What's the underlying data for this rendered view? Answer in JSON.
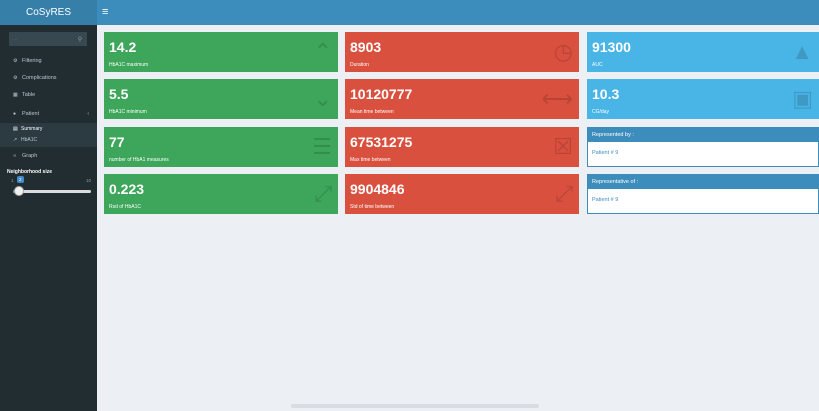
{
  "app": {
    "title": "CoSyRES"
  },
  "search": {
    "placeholder": "..."
  },
  "sidebar": {
    "items": [
      {
        "label": "Filtering",
        "icon": "filter-icon"
      },
      {
        "label": "Complications",
        "icon": "gears-icon"
      },
      {
        "label": "Table",
        "icon": "table-icon"
      },
      {
        "label": "Patient",
        "icon": "user-icon"
      }
    ],
    "submenu": [
      {
        "label": "Summary",
        "icon": "summary-icon"
      },
      {
        "label": "HbA1C",
        "icon": "line-chart-icon"
      }
    ],
    "graph": {
      "label": "Graph",
      "icon": "share-icon"
    }
  },
  "slider": {
    "label": "Neighborhood size",
    "min": "1",
    "max": "10",
    "value": "2"
  },
  "value_boxes": [
    {
      "value": "14.2",
      "subtitle": "HbA1C maximum",
      "color": "#3da65a"
    },
    {
      "value": "8903",
      "subtitle": "Duration",
      "color": "#d9503f"
    },
    {
      "value": "91300",
      "subtitle": "AUC",
      "color": "#49b5e7"
    },
    {
      "value": "5.5",
      "subtitle": "HbA1C minimum",
      "color": "#3da65a"
    },
    {
      "value": "10120777",
      "subtitle": "Mean time between",
      "color": "#d9503f"
    },
    {
      "value": "10.3",
      "subtitle": "CG/day",
      "color": "#49b5e7"
    },
    {
      "value": "77",
      "subtitle": "number of HbA1 measures",
      "color": "#3da65a"
    },
    {
      "value": "67531275",
      "subtitle": "Max time between",
      "color": "#d9503f"
    },
    {
      "value": "0.223",
      "subtitle": "Rsd of HbA1C",
      "color": "#3da65a"
    },
    {
      "value": "9904846",
      "subtitle": "Std of time between",
      "color": "#d9503f"
    }
  ],
  "info_boxes": [
    {
      "title": "Represented by :",
      "body": "Patient # 9"
    },
    {
      "title": "Representative of :",
      "body": "Patient # 9"
    }
  ]
}
